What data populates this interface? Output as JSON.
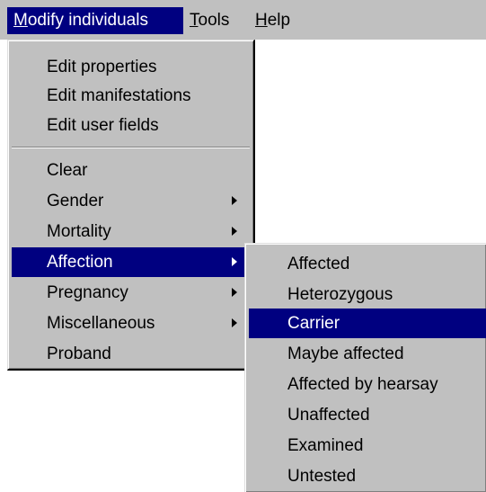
{
  "menubar": {
    "items": [
      {
        "label": "Modify individuals",
        "hotkey": "M",
        "rest": "odify individuals",
        "active": true
      },
      {
        "label": "Tools",
        "hotkey": "T",
        "rest": "ools",
        "active": false
      },
      {
        "label": "Help",
        "hotkey": "H",
        "rest": "elp",
        "active": false
      }
    ]
  },
  "main_menu": {
    "items": [
      {
        "label": "Edit properties"
      },
      {
        "label": "Edit manifestations"
      },
      {
        "label": "Edit user fields"
      },
      {
        "label": "Clear"
      },
      {
        "label": "Gender",
        "submenu": true
      },
      {
        "label": "Mortality",
        "submenu": true
      },
      {
        "label": "Affection",
        "submenu": true,
        "highlighted": true
      },
      {
        "label": "Pregnancy",
        "submenu": true
      },
      {
        "label": "Miscellaneous",
        "submenu": true
      },
      {
        "label": "Proband"
      }
    ]
  },
  "affection_submenu": {
    "items": [
      {
        "label": "Affected"
      },
      {
        "label": "Heterozygous"
      },
      {
        "label": "Carrier",
        "highlighted": true
      },
      {
        "label": "Maybe affected"
      },
      {
        "label": "Affected by hearsay"
      },
      {
        "label": "Unaffected"
      },
      {
        "label": "Examined"
      },
      {
        "label": "Untested"
      }
    ]
  },
  "colors": {
    "menu_face": "#c0c0c0",
    "highlight": "#000080",
    "highlight_text": "#ffffff"
  }
}
